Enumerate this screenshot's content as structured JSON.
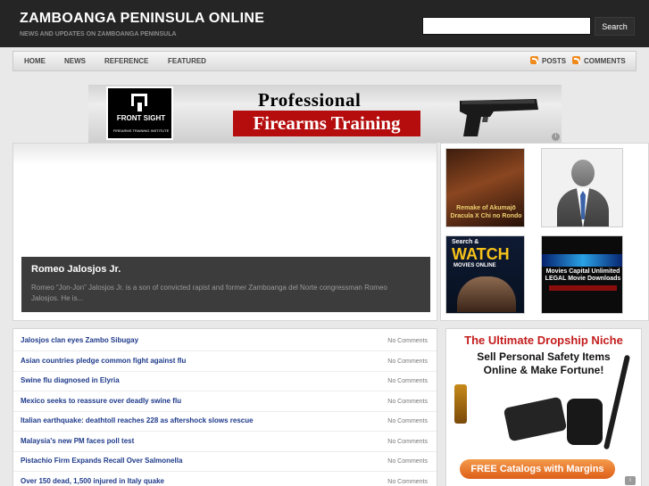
{
  "header": {
    "site_title": "ZAMBOANGA PENINSULA ONLINE",
    "tagline": "NEWS AND UPDATES ON ZAMBOANGA PENINSULA",
    "search_placeholder": "",
    "search_button": "Search"
  },
  "nav": {
    "items": [
      {
        "label": "HOME"
      },
      {
        "label": "NEWS"
      },
      {
        "label": "REFERENCE"
      },
      {
        "label": "FEATURED"
      }
    ],
    "feeds": [
      {
        "label": "POSTS",
        "icon": "rss-icon"
      },
      {
        "label": "COMMENTS",
        "icon": "rss-icon"
      }
    ]
  },
  "banner_ad": {
    "logo_name": "FRONT SIGHT",
    "logo_sub": "FIREARMS TRAINING INSTITUTE",
    "line1": "Professional",
    "line2": "Firearms Training",
    "colors": {
      "accent": "#b50d0d"
    }
  },
  "featured": {
    "title": "Romeo Jalosjos Jr.",
    "excerpt": "Romeo “Jon-Jon” Jalosjos Jr. is a son of convicted rapist and former Zamboanga del Norte congressman Romeo Jalosjos. He is..."
  },
  "thumbnails": [
    {
      "name": "Remake of Akumajō Dracula X Chi no Rondo",
      "text": "Remake of Akumajō Dracula X Chi no Rondo"
    },
    {
      "name": "avatar-placeholder",
      "text": ""
    },
    {
      "name": "Search & Watch Movies Online",
      "top": "Search &",
      "big": "WATCH",
      "small": "MOVIES ONLINE"
    },
    {
      "name": "Movies Capital",
      "text": "Movies Capital Unlimited LEGAL Movie Downloads"
    }
  ],
  "posts": [
    {
      "title": "Jalosjos clan eyes Zambo Sibugay",
      "comments": "No Comments"
    },
    {
      "title": "Asian countries pledge common fight against flu",
      "comments": "No Comments"
    },
    {
      "title": "Swine flu diagnosed in Elyria",
      "comments": "No Comments"
    },
    {
      "title": "Mexico seeks to reassure over deadly swine flu",
      "comments": "No Comments"
    },
    {
      "title": "Italian earthquake: deathtoll reaches 228 as aftershock slows rescue",
      "comments": "No Comments"
    },
    {
      "title": "Malaysia's new PM faces poll test",
      "comments": "No Comments"
    },
    {
      "title": "Pistachio Firm Expands Recall Over Salmonella",
      "comments": "No Comments"
    },
    {
      "title": "Over 150 dead, 1,500 injured in Italy quake",
      "comments": "No Comments"
    }
  ],
  "side_ad": {
    "headline": "The Ultimate Dropship Niche",
    "sub_line1": "Sell Personal Safety Items",
    "sub_line2": "Online & Make  Fortune!",
    "cta": "FREE Catalogs with Margins",
    "colors": {
      "headline": "#c41d1d",
      "cta": "#e8772c"
    }
  }
}
